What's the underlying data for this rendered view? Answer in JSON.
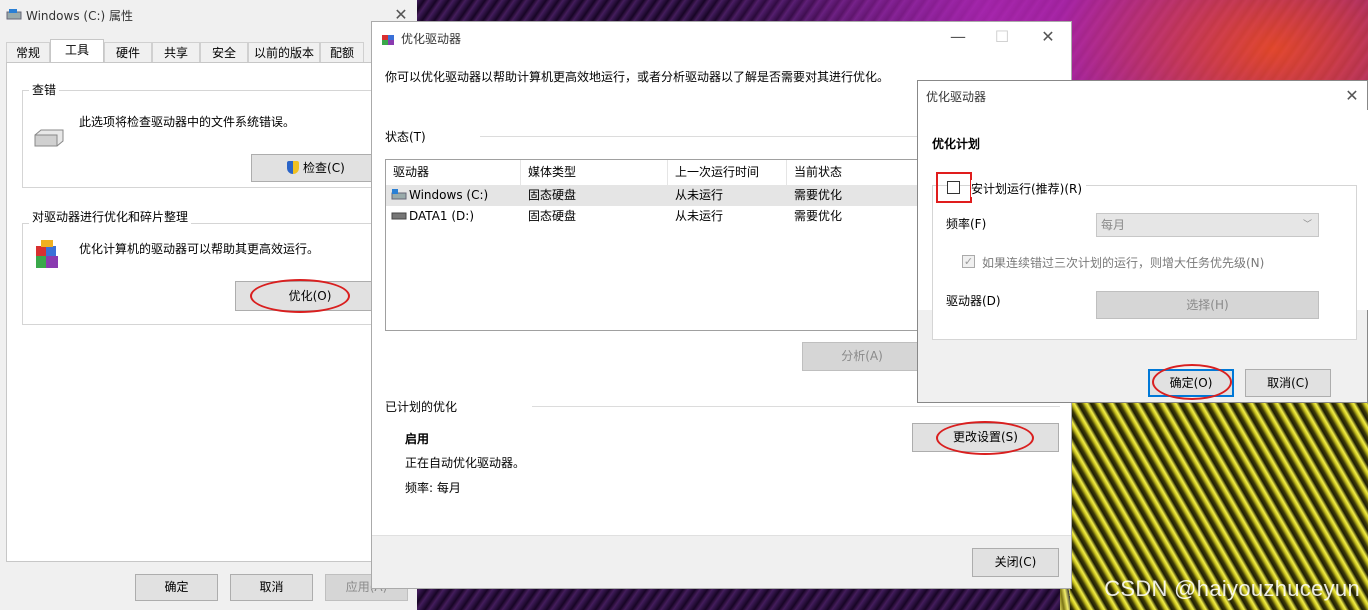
{
  "props_window": {
    "title": "Windows (C:) 属性",
    "tabs": [
      "常规",
      "工具",
      "硬件",
      "共享",
      "安全",
      "以前的版本",
      "配额"
    ],
    "active_tab": "工具",
    "check_group": {
      "title": "查错",
      "desc": "此选项将检查驱动器中的文件系统错误。",
      "button": "检查(C)"
    },
    "optimize_group": {
      "title": "对驱动器进行优化和碎片整理",
      "desc": "优化计算机的驱动器可以帮助其更高效运行。",
      "button": "优化(O)"
    },
    "footer": {
      "ok": "确定",
      "cancel": "取消",
      "apply": "应用(A)"
    }
  },
  "optimize_window": {
    "title": "优化驱动器",
    "intro": "你可以优化驱动器以帮助计算机更高效地运行，或者分析驱动器以了解是否需要对其进行优化。",
    "status_label": "状态(T)",
    "columns": [
      "驱动器",
      "媒体类型",
      "上一次运行时间",
      "当前状态"
    ],
    "rows": [
      {
        "drive": "Windows (C:)",
        "media": "固态硬盘",
        "last_run": "从未运行",
        "status": "需要优化"
      },
      {
        "drive": "DATA1 (D:)",
        "media": "固态硬盘",
        "last_run": "从未运行",
        "status": "需要优化"
      }
    ],
    "analyze_button": "分析(A)",
    "scheduled_label": "已计划的优化",
    "scheduled_state": "启用",
    "scheduled_desc": "正在自动优化驱动器。",
    "scheduled_freq": "频率: 每月",
    "change_settings": "更改设置(S)",
    "close_button": "关闭(C)"
  },
  "schedule_dialog": {
    "title": "优化驱动器",
    "section": "优化计划",
    "run_on_schedule": "按计划运行(推荐)(R)",
    "run_on_schedule_visible": "安计划运行(推荐)(R)",
    "run_on_schedule_checked": false,
    "frequency_label": "频率(F)",
    "frequency_value": "每月",
    "priority_option": "如果连续错过三次计划的运行，则增大任务优先级(N)",
    "drives_label": "驱动器(D)",
    "choose_button": "选择(H)",
    "ok": "确定(O)",
    "cancel": "取消(C)"
  },
  "watermark": "CSDN @haiyouzhuceyun",
  "colors": {
    "highlight": "#d91f1f",
    "accent": "#0078d7"
  }
}
